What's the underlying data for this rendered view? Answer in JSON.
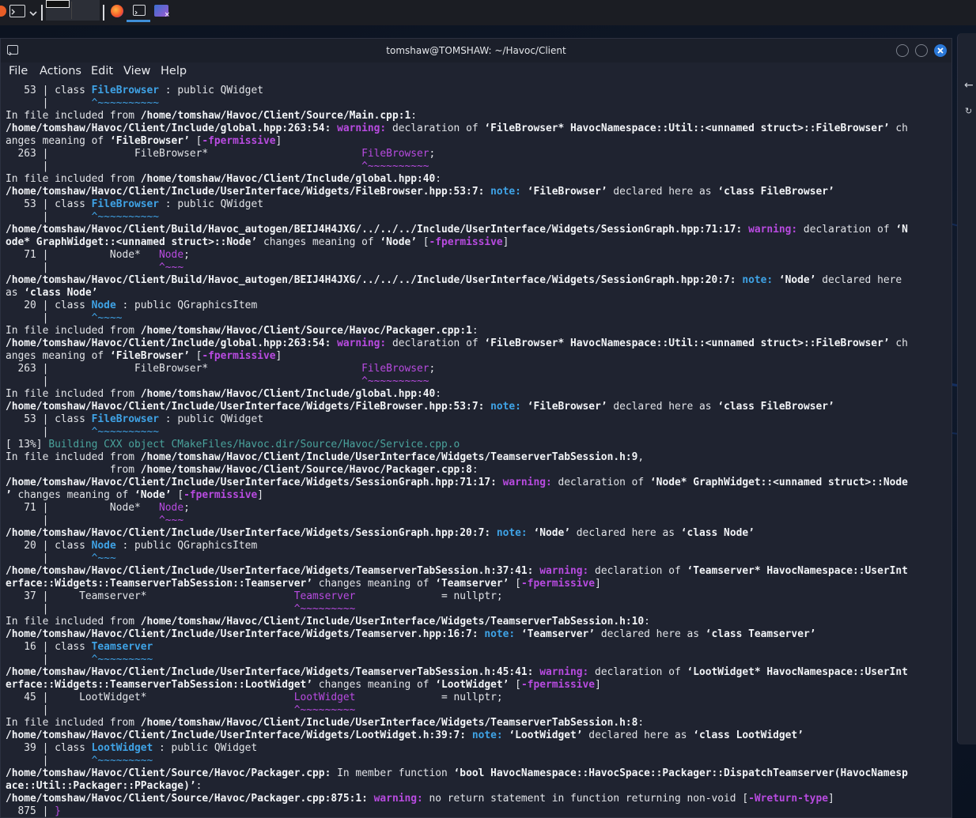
{
  "window": {
    "title": "tomshaw@TOMSHAW: ~/Havoc/Client"
  },
  "menu": [
    "File",
    "Actions",
    "Edit",
    "View",
    "Help"
  ],
  "taskbar": {
    "icons": [
      "app-menu-icon",
      "terminal-icon",
      "chevron-down-icon",
      "workspace-switcher-icon",
      "firefox-icon",
      "terminal-icon",
      "screen-icon"
    ]
  },
  "colors": {
    "terminal_bg": "#1f2330",
    "warning": "#b84be0",
    "note": "#3fa3e6",
    "progress": "#4aa39c"
  },
  "lines": [
    [
      [
        "n",
        "   53 | class "
      ],
      [
        "c",
        "FileBrowser"
      ],
      [
        "n",
        " : public QWidget"
      ]
    ],
    [
      [
        "n",
        "      |       "
      ],
      [
        "car",
        "^~~~~~~~~~~"
      ]
    ],
    [
      [
        "n",
        "In file included from "
      ],
      [
        "b",
        "/home/tomshaw/Havoc/Client/Source/Main.cpp:1"
      ],
      [
        "n",
        ":"
      ]
    ],
    [
      [
        "b",
        "/home/tomshaw/Havoc/Client/Include/global.hpp:263:54:"
      ],
      [
        "n",
        " "
      ],
      [
        "m",
        "warning:"
      ],
      [
        "n",
        " declaration of "
      ],
      [
        "b",
        "‘FileBrowser* HavocNamespace::Util::<unnamed struct>::FileBrowser’"
      ],
      [
        "n",
        " ch"
      ]
    ],
    [
      [
        "n",
        "anges meaning of "
      ],
      [
        "b",
        "‘FileBrowser’"
      ],
      [
        "n",
        " ["
      ],
      [
        "m",
        "-fpermissive"
      ],
      [
        "n",
        "]"
      ]
    ],
    [
      [
        "n",
        "  263 |              FileBrowser*                         "
      ],
      [
        "cm",
        "FileBrowser"
      ],
      [
        "n",
        ";"
      ]
    ],
    [
      [
        "n",
        "      |                                                   "
      ],
      [
        "cm",
        "^~~~~~~~~~~"
      ]
    ],
    [
      [
        "n",
        "In file included from "
      ],
      [
        "b",
        "/home/tomshaw/Havoc/Client/Include/global.hpp:40"
      ],
      [
        "n",
        ":"
      ]
    ],
    [
      [
        "b",
        "/home/tomshaw/Havoc/Client/Include/UserInterface/Widgets/FileBrowser.hpp:53:7:"
      ],
      [
        "n",
        " "
      ],
      [
        "c",
        "note:"
      ],
      [
        "n",
        " "
      ],
      [
        "b",
        "‘FileBrowser’"
      ],
      [
        "n",
        " declared here as "
      ],
      [
        "b",
        "‘class FileBrowser’"
      ]
    ],
    [
      [
        "n",
        "   53 | class "
      ],
      [
        "c",
        "FileBrowser"
      ],
      [
        "n",
        " : public QWidget"
      ]
    ],
    [
      [
        "n",
        "      |       "
      ],
      [
        "car",
        "^~~~~~~~~~~"
      ]
    ],
    [
      [
        "b",
        "/home/tomshaw/Havoc/Client/Build/Havoc_autogen/BEIJ4H4JXG/../../../Include/UserInterface/Widgets/SessionGraph.hpp:71:17:"
      ],
      [
        "n",
        " "
      ],
      [
        "m",
        "warning:"
      ],
      [
        "n",
        " declaration of "
      ],
      [
        "b",
        "‘N"
      ]
    ],
    [
      [
        "b",
        "ode* GraphWidget::<unnamed struct>::Node’"
      ],
      [
        "n",
        " changes meaning of "
      ],
      [
        "b",
        "‘Node’"
      ],
      [
        "n",
        " ["
      ],
      [
        "m",
        "-fpermissive"
      ],
      [
        "n",
        "]"
      ]
    ],
    [
      [
        "n",
        "   71 |          Node*   "
      ],
      [
        "cm",
        "Node"
      ],
      [
        "n",
        ";"
      ]
    ],
    [
      [
        "n",
        "      |                  "
      ],
      [
        "cm",
        "^~~~"
      ]
    ],
    [
      [
        "b",
        "/home/tomshaw/Havoc/Client/Build/Havoc_autogen/BEIJ4H4JXG/../../../Include/UserInterface/Widgets/SessionGraph.hpp:20:7:"
      ],
      [
        "n",
        " "
      ],
      [
        "c",
        "note:"
      ],
      [
        "n",
        " "
      ],
      [
        "b",
        "‘Node’"
      ],
      [
        "n",
        " declared here"
      ]
    ],
    [
      [
        "n",
        "as "
      ],
      [
        "b",
        "‘class Node’"
      ]
    ],
    [
      [
        "n",
        "   20 | class "
      ],
      [
        "c",
        "Node"
      ],
      [
        "n",
        " : public QGraphicsItem"
      ]
    ],
    [
      [
        "n",
        "      |       "
      ],
      [
        "car",
        "^~~~~"
      ]
    ],
    [
      [
        "n",
        "In file included from "
      ],
      [
        "b",
        "/home/tomshaw/Havoc/Client/Source/Havoc/Packager.cpp:1"
      ],
      [
        "n",
        ":"
      ]
    ],
    [
      [
        "b",
        "/home/tomshaw/Havoc/Client/Include/global.hpp:263:54:"
      ],
      [
        "n",
        " "
      ],
      [
        "m",
        "warning:"
      ],
      [
        "n",
        " declaration of "
      ],
      [
        "b",
        "‘FileBrowser* HavocNamespace::Util::<unnamed struct>::FileBrowser’"
      ],
      [
        "n",
        " ch"
      ]
    ],
    [
      [
        "n",
        "anges meaning of "
      ],
      [
        "b",
        "‘FileBrowser’"
      ],
      [
        "n",
        " ["
      ],
      [
        "m",
        "-fpermissive"
      ],
      [
        "n",
        "]"
      ]
    ],
    [
      [
        "n",
        "  263 |              FileBrowser*                         "
      ],
      [
        "cm",
        "FileBrowser"
      ],
      [
        "n",
        ";"
      ]
    ],
    [
      [
        "n",
        "      |                                                   "
      ],
      [
        "cm",
        "^~~~~~~~~~~"
      ]
    ],
    [
      [
        "n",
        "In file included from "
      ],
      [
        "b",
        "/home/tomshaw/Havoc/Client/Include/global.hpp:40"
      ],
      [
        "n",
        ":"
      ]
    ],
    [
      [
        "b",
        "/home/tomshaw/Havoc/Client/Include/UserInterface/Widgets/FileBrowser.hpp:53:7:"
      ],
      [
        "n",
        " "
      ],
      [
        "c",
        "note:"
      ],
      [
        "n",
        " "
      ],
      [
        "b",
        "‘FileBrowser’"
      ],
      [
        "n",
        " declared here as "
      ],
      [
        "b",
        "‘class FileBrowser’"
      ]
    ],
    [
      [
        "n",
        "   53 | class "
      ],
      [
        "c",
        "FileBrowser"
      ],
      [
        "n",
        " : public QWidget"
      ]
    ],
    [
      [
        "n",
        "      |       "
      ],
      [
        "car",
        "^~~~~~~~~~~"
      ]
    ],
    [
      [
        "n",
        "[ 13%] "
      ],
      [
        "k",
        "Building CXX object CMakeFiles/Havoc.dir/Source/Havoc/Service.cpp.o"
      ]
    ],
    [
      [
        "n",
        "In file included from "
      ],
      [
        "b",
        "/home/tomshaw/Havoc/Client/Include/UserInterface/Widgets/TeamserverTabSession.h:9"
      ],
      [
        "n",
        ","
      ]
    ],
    [
      [
        "n",
        "                 from "
      ],
      [
        "b",
        "/home/tomshaw/Havoc/Client/Source/Havoc/Packager.cpp:8"
      ],
      [
        "n",
        ":"
      ]
    ],
    [
      [
        "b",
        "/home/tomshaw/Havoc/Client/Include/UserInterface/Widgets/SessionGraph.hpp:71:17:"
      ],
      [
        "n",
        " "
      ],
      [
        "m",
        "warning:"
      ],
      [
        "n",
        " declaration of "
      ],
      [
        "b",
        "‘Node* GraphWidget::<unnamed struct>::Node"
      ]
    ],
    [
      [
        "b",
        "’"
      ],
      [
        "n",
        " changes meaning of "
      ],
      [
        "b",
        "‘Node’"
      ],
      [
        "n",
        " ["
      ],
      [
        "m",
        "-fpermissive"
      ],
      [
        "n",
        "]"
      ]
    ],
    [
      [
        "n",
        "   71 |          Node*   "
      ],
      [
        "cm",
        "Node"
      ],
      [
        "n",
        ";"
      ]
    ],
    [
      [
        "n",
        "      |                  "
      ],
      [
        "cm",
        "^~~~"
      ]
    ],
    [
      [
        "b",
        "/home/tomshaw/Havoc/Client/Include/UserInterface/Widgets/SessionGraph.hpp:20:7:"
      ],
      [
        "n",
        " "
      ],
      [
        "c",
        "note:"
      ],
      [
        "n",
        " "
      ],
      [
        "b",
        "‘Node’"
      ],
      [
        "n",
        " declared here as "
      ],
      [
        "b",
        "‘class Node’"
      ]
    ],
    [
      [
        "n",
        "   20 | class "
      ],
      [
        "c",
        "Node"
      ],
      [
        "n",
        " : public QGraphicsItem"
      ]
    ],
    [
      [
        "n",
        "      |       "
      ],
      [
        "car",
        "^~~~"
      ]
    ],
    [
      [
        "b",
        "/home/tomshaw/Havoc/Client/Include/UserInterface/Widgets/TeamserverTabSession.h:37:41:"
      ],
      [
        "n",
        " "
      ],
      [
        "m",
        "warning:"
      ],
      [
        "n",
        " declaration of "
      ],
      [
        "b",
        "‘Teamserver* HavocNamespace::UserInt"
      ]
    ],
    [
      [
        "b",
        "erface::Widgets::TeamserverTabSession::Teamserver’"
      ],
      [
        "n",
        " changes meaning of "
      ],
      [
        "b",
        "‘Teamserver’"
      ],
      [
        "n",
        " ["
      ],
      [
        "m",
        "-fpermissive"
      ],
      [
        "n",
        "]"
      ]
    ],
    [
      [
        "n",
        "   37 |     Teamserver*                        "
      ],
      [
        "cm",
        "Teamserver"
      ],
      [
        "n",
        "              = nullptr;"
      ]
    ],
    [
      [
        "n",
        "      |                                        "
      ],
      [
        "cm",
        "^~~~~~~~~~"
      ]
    ],
    [
      [
        "n",
        "In file included from "
      ],
      [
        "b",
        "/home/tomshaw/Havoc/Client/Include/UserInterface/Widgets/TeamserverTabSession.h:10"
      ],
      [
        "n",
        ":"
      ]
    ],
    [
      [
        "b",
        "/home/tomshaw/Havoc/Client/Include/UserInterface/Widgets/Teamserver.hpp:16:7:"
      ],
      [
        "n",
        " "
      ],
      [
        "c",
        "note:"
      ],
      [
        "n",
        " "
      ],
      [
        "b",
        "‘Teamserver’"
      ],
      [
        "n",
        " declared here as "
      ],
      [
        "b",
        "‘class Teamserver’"
      ]
    ],
    [
      [
        "n",
        "   16 | class "
      ],
      [
        "c",
        "Teamserver"
      ]
    ],
    [
      [
        "n",
        "      |       "
      ],
      [
        "car",
        "^~~~~~~~~~"
      ]
    ],
    [
      [
        "b",
        "/home/tomshaw/Havoc/Client/Include/UserInterface/Widgets/TeamserverTabSession.h:45:41:"
      ],
      [
        "n",
        " "
      ],
      [
        "m",
        "warning:"
      ],
      [
        "n",
        " declaration of "
      ],
      [
        "b",
        "‘LootWidget* HavocNamespace::UserInt"
      ]
    ],
    [
      [
        "b",
        "erface::Widgets::TeamserverTabSession::LootWidget’"
      ],
      [
        "n",
        " changes meaning of "
      ],
      [
        "b",
        "‘LootWidget’"
      ],
      [
        "n",
        " ["
      ],
      [
        "m",
        "-fpermissive"
      ],
      [
        "n",
        "]"
      ]
    ],
    [
      [
        "n",
        "   45 |     LootWidget*                        "
      ],
      [
        "cm",
        "LootWidget"
      ],
      [
        "n",
        "              = nullptr;"
      ]
    ],
    [
      [
        "n",
        "      |                                        "
      ],
      [
        "cm",
        "^~~~~~~~~~"
      ]
    ],
    [
      [
        "n",
        "In file included from "
      ],
      [
        "b",
        "/home/tomshaw/Havoc/Client/Include/UserInterface/Widgets/TeamserverTabSession.h:8"
      ],
      [
        "n",
        ":"
      ]
    ],
    [
      [
        "b",
        "/home/tomshaw/Havoc/Client/Include/UserInterface/Widgets/LootWidget.h:39:7:"
      ],
      [
        "n",
        " "
      ],
      [
        "c",
        "note:"
      ],
      [
        "n",
        " "
      ],
      [
        "b",
        "‘LootWidget’"
      ],
      [
        "n",
        " declared here as "
      ],
      [
        "b",
        "‘class LootWidget’"
      ]
    ],
    [
      [
        "n",
        "   39 | class "
      ],
      [
        "c",
        "LootWidget"
      ],
      [
        "n",
        " : public QWidget"
      ]
    ],
    [
      [
        "n",
        "      |       "
      ],
      [
        "car",
        "^~~~~~~~~~"
      ]
    ],
    [
      [
        "b",
        "/home/tomshaw/Havoc/Client/Source/Havoc/Packager.cpp:"
      ],
      [
        "n",
        " In member function "
      ],
      [
        "b",
        "‘bool HavocNamespace::HavocSpace::Packager::DispatchTeamserver(HavocNamesp"
      ]
    ],
    [
      [
        "b",
        "ace::Util::Packager::PPackage)’"
      ],
      [
        "n",
        ":"
      ]
    ],
    [
      [
        "b",
        "/home/tomshaw/Havoc/Client/Source/Havoc/Packager.cpp:875:1:"
      ],
      [
        "n",
        " "
      ],
      [
        "m",
        "warning:"
      ],
      [
        "n",
        " no return statement in function returning non-void ["
      ],
      [
        "m",
        "-Wreturn-type"
      ],
      [
        "n",
        "]"
      ]
    ],
    [
      [
        "n",
        "  875 | "
      ],
      [
        "cm",
        "}"
      ]
    ]
  ]
}
